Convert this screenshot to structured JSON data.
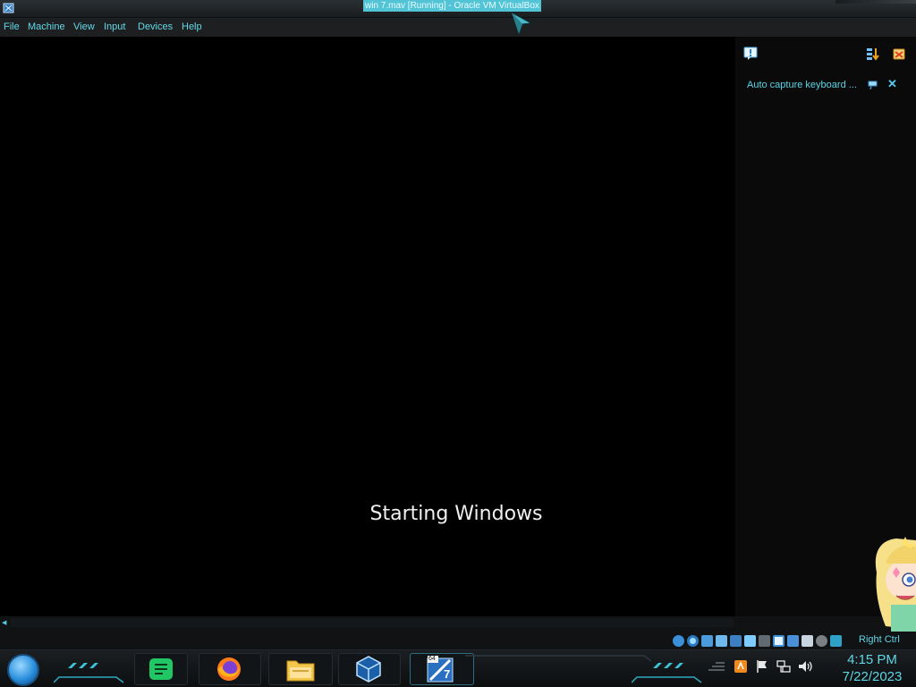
{
  "window": {
    "title": "win 7.mav [Running] - Oracle VM VirtualBox",
    "app_icon": "virtualbox-icon"
  },
  "menubar": {
    "items": [
      {
        "label": "File"
      },
      {
        "label": "Machine"
      },
      {
        "label": "View"
      },
      {
        "label": "Input"
      },
      {
        "label": "Devices"
      },
      {
        "label": "Help"
      }
    ]
  },
  "vm": {
    "boot_message": "Starting Windows"
  },
  "notification_panel": {
    "top_left_icon": "info-message-icon",
    "top_right_icons": [
      "sort-notifications-icon",
      "clear-notifications-icon"
    ],
    "message": "Auto capture keyboard ...",
    "pin_icon": "pin-icon",
    "close_icon": "close-icon"
  },
  "statusbar": {
    "icons": [
      "hard-disk-icon",
      "optical-disc-icon",
      "audio-icon",
      "network-icon",
      "usb-icon",
      "shared-folder-icon",
      "display-icon",
      "recording-icon",
      "cpu-icon",
      "mouse-integration-icon",
      "keyboard-icon"
    ],
    "host_key": "Right Ctrl"
  },
  "taskbar": {
    "pinned": [
      {
        "name": "notes-app",
        "icon": "chat-notes-icon"
      },
      {
        "name": "firefox",
        "icon": "firefox-icon"
      },
      {
        "name": "file-explorer",
        "icon": "folder-icon"
      },
      {
        "name": "virtualbox",
        "icon": "virtualbox-icon"
      },
      {
        "name": "vm-win7",
        "icon": "windows7-vm-icon",
        "badge": "64",
        "label": "7"
      }
    ],
    "tray_icons": [
      "show-hidden-icon",
      "app-orange-icon",
      "flag-icon",
      "network-tray-icon",
      "volume-icon"
    ],
    "clock": {
      "time": "4:15 PM",
      "date": "7/22/2023"
    }
  },
  "colors": {
    "accent": "#5fd6e6",
    "title_highlight": "#53c4d6",
    "background": "#000000"
  }
}
